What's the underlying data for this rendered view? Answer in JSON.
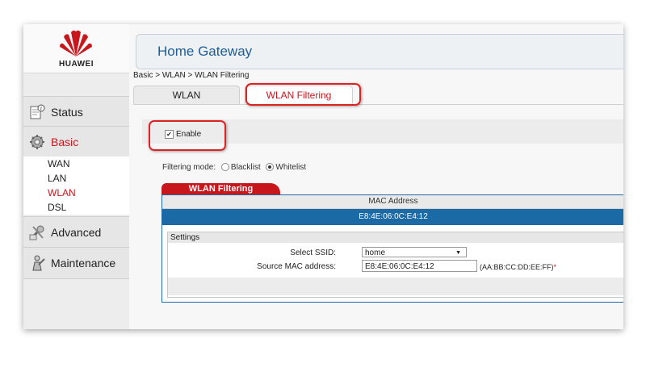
{
  "brand": {
    "logo_text": "HUAWEI",
    "accent": "#c8161d",
    "blue": "#1b6aa5"
  },
  "header": {
    "title": "Home Gateway"
  },
  "breadcrumb": "Basic > WLAN > WLAN Filtering",
  "tabs": [
    {
      "label": "WLAN",
      "active": false
    },
    {
      "label": "WLAN Filtering",
      "active": true
    }
  ],
  "sidebar": {
    "items": [
      {
        "label": "Status",
        "icon": "status-icon",
        "active": false
      },
      {
        "label": "Basic",
        "icon": "basic-gear-icon",
        "active": true
      },
      {
        "label": "Advanced",
        "icon": "advanced-tools-icon",
        "active": false
      },
      {
        "label": "Maintenance",
        "icon": "maintenance-icon",
        "active": false
      }
    ],
    "subitems": [
      {
        "label": "WAN",
        "active": false
      },
      {
        "label": "LAN",
        "active": false
      },
      {
        "label": "WLAN",
        "active": true
      },
      {
        "label": "DSL",
        "active": false
      }
    ]
  },
  "enable": {
    "label": "Enable",
    "checked": true
  },
  "filter": {
    "label": "Filtering mode:",
    "options": [
      "Blacklist",
      "Whitelist"
    ],
    "selected": "Whitelist"
  },
  "table": {
    "tab_label": "WLAN Filtering",
    "column_header": "MAC Address",
    "rows": [
      "E8:4E:06:0C:E4:12"
    ]
  },
  "settings": {
    "title": "Settings",
    "ssid_label": "Select SSID:",
    "ssid_value": "home",
    "mac_label": "Source MAC address:",
    "mac_value": "E8:4E:06:0C:E4:12",
    "mac_hint": "(AA:BB:CC:DD:EE:FF)",
    "required_mark": "*"
  }
}
